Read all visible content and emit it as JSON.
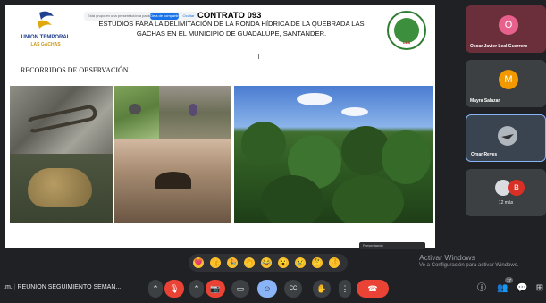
{
  "slide": {
    "logo_title": "UNION TEMPORAL",
    "logo_subtitle": "LAS GACHAS",
    "share_banner_text": "Está grupo en una presentación a pantalla",
    "share_banner_primary": "Deja de compartir",
    "share_banner_secondary": "Ocultar",
    "contract": "CONTRATO 093",
    "title_line1": "ESTUDIOS PARA LA DELIMITACIÓN DE LA RONDA HÍDRICA DE LA QUEBRADA LAS",
    "title_line2": "GACHAS EN EL MUNICIPIO DE GUADALUPE, SANTANDER.",
    "seal_text": "CAS",
    "section_heading": "RECORRIDOS DE OBSERVACIÓN"
  },
  "participants": [
    {
      "initial": "O",
      "name": "Oscar Javier Leal Guerrero",
      "color": "#e8618c"
    },
    {
      "initial": "M",
      "name": "Mayra Salazar",
      "color": "#f29900"
    },
    {
      "name": "Omar Reyes"
    },
    {
      "initial": "B",
      "more_label": "12 más",
      "color": "#d93025"
    }
  ],
  "bottom": {
    "presenter_label": "Presentando",
    "activate_title": "Activar Windows",
    "activate_sub": "Ve a Configuración para activar Windows.",
    "time_suffix": ".m.",
    "separator": "|",
    "meeting_name": "REUNION SEGUIMIENTO SEMAN...",
    "participant_count": "17",
    "reactions": [
      "💗",
      "👍",
      "🎉",
      "👏",
      "😂",
      "😮",
      "😢",
      "🤔",
      "👎"
    ],
    "controls": {
      "mic_toggle": "⌃",
      "mic": "🎙",
      "cam_toggle": "⌃",
      "cam": "📷",
      "present": "▭",
      "emoji": "☺",
      "captions": "CC",
      "hand": "✋",
      "more": "⋮",
      "hangup": "☎"
    },
    "right_icons": {
      "info": "ⓘ",
      "people": "👥",
      "chat": "💬",
      "activities": "⊞"
    }
  }
}
